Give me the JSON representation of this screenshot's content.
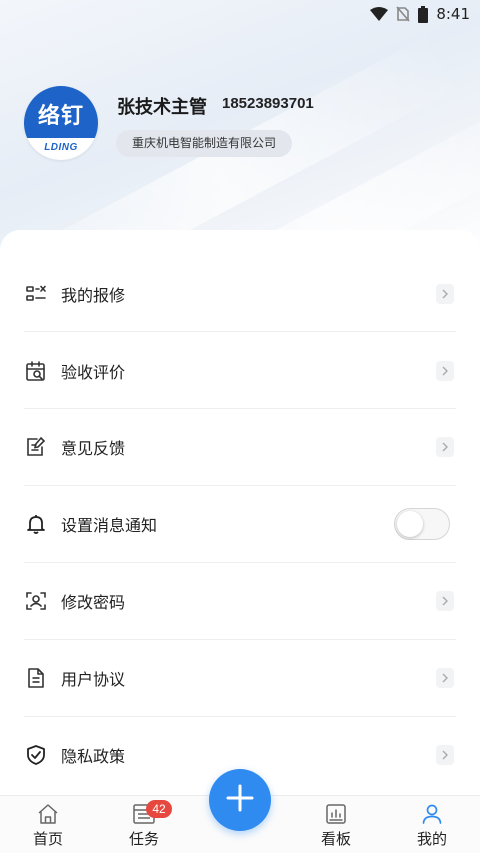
{
  "status_bar": {
    "time": "8:41"
  },
  "profile": {
    "logo_cn": "络钉",
    "logo_en": "LDING",
    "name": "张技术主管",
    "phone": "18523893701",
    "company": "重庆机电智能制造有限公司"
  },
  "menu": {
    "items": [
      {
        "label": "我的报修",
        "icon": "repair-list-icon"
      },
      {
        "label": "验收评价",
        "icon": "calendar-search-icon"
      },
      {
        "label": "意见反馈",
        "icon": "feedback-edit-icon"
      },
      {
        "label": "设置消息通知",
        "icon": "bell-icon",
        "toggle": false
      },
      {
        "label": "修改密码",
        "icon": "face-scan-icon"
      },
      {
        "label": "用户协议",
        "icon": "document-icon"
      },
      {
        "label": "隐私政策",
        "icon": "shield-check-icon"
      }
    ]
  },
  "tabbar": {
    "tabs": [
      {
        "label": "首页",
        "icon": "home-icon"
      },
      {
        "label": "任务",
        "icon": "task-list-icon",
        "badge": "42"
      },
      {
        "label": "看板",
        "icon": "dashboard-icon"
      },
      {
        "label": "我的",
        "icon": "user-icon",
        "active": true
      }
    ]
  },
  "colors": {
    "accent": "#2f8bf0",
    "badge": "#e6483f",
    "brand": "#1e63c8"
  }
}
